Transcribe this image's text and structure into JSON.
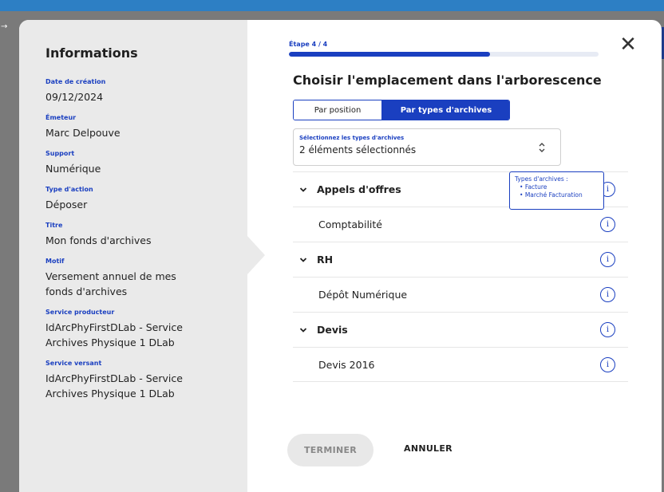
{
  "backdrop": {
    "arrow": "→"
  },
  "info": {
    "title": "Informations",
    "items": [
      {
        "label": "Date de création",
        "value": "09/12/2024"
      },
      {
        "label": "Émeteur",
        "value": "Marc Delpouve"
      },
      {
        "label": "Support",
        "value": "Numérique"
      },
      {
        "label": "Type d'action",
        "value": "Déposer"
      },
      {
        "label": "Titre",
        "value": "Mon fonds d'archives"
      },
      {
        "label": "Motif",
        "value": "Versement annuel de mes fonds d'archives"
      },
      {
        "label": "Service producteur",
        "value": "IdArcPhyFirstDLab - Service Archives Physique 1 DLab"
      },
      {
        "label": "Service versant",
        "value": "IdArcPhyFirstDLab - Service Archives Physique 1 DLab"
      }
    ]
  },
  "step": {
    "label": "Étape  4 / 4",
    "progress": 0.65
  },
  "close_glyph": "✕",
  "title": "Choisir l'emplacement dans l'arborescence",
  "segment": {
    "option_a": "Par position",
    "option_b": "Par types d'archives",
    "selected": "option_b"
  },
  "select": {
    "label": "Sélectionnez les types d'archives",
    "value": "2 éléments sélectionnés",
    "chevron": "⌃⌄"
  },
  "tree": [
    {
      "caret": "⌄",
      "label": "Appels d'offres",
      "bold": true
    },
    {
      "caret": "",
      "label": "Comptabilité",
      "bold": false
    },
    {
      "caret": "⌄",
      "label": "RH",
      "bold": true
    },
    {
      "caret": "",
      "label": "Dépôt Numérique",
      "bold": false
    },
    {
      "caret": "⌄",
      "label": "Devis",
      "bold": true
    },
    {
      "caret": "",
      "label": "Devis 2016",
      "bold": false
    }
  ],
  "info_glyph": "i",
  "tooltip": {
    "title": "Types d'archives :",
    "items": [
      "Facture",
      "Marché Facturation"
    ]
  },
  "actions": {
    "finish": "TERMINER",
    "cancel": "ANNULER"
  },
  "colors": {
    "accent": "#1a3fc0",
    "panel": "#eaeaea"
  }
}
